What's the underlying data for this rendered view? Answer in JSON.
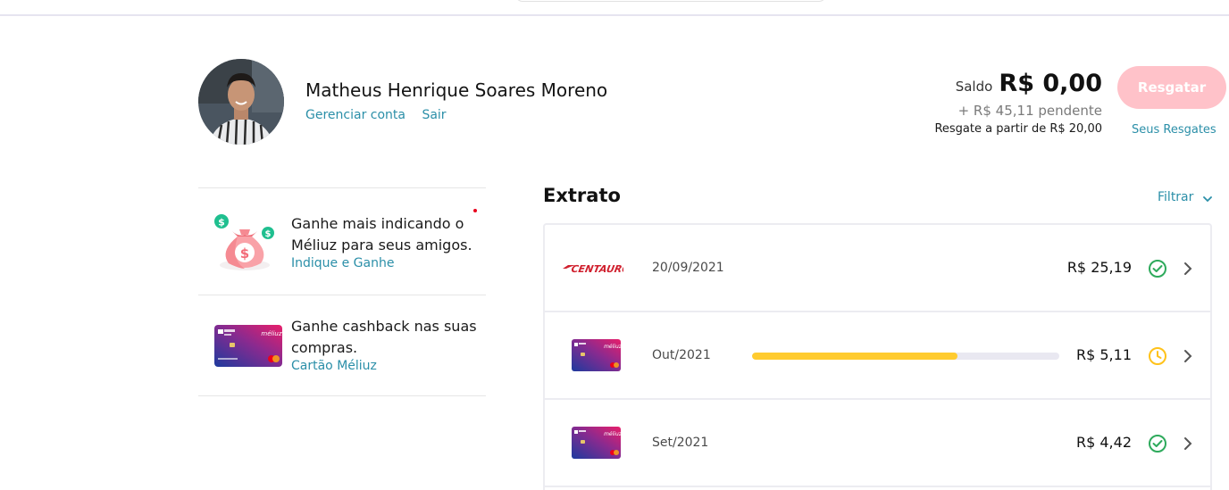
{
  "user": {
    "name": "Matheus Henrique Soares Moreno",
    "manage_label": "Gerenciar conta",
    "logout_label": "Sair"
  },
  "balance": {
    "label": "Saldo",
    "amount": "R$ 0,00",
    "pending": "+ R$ 45,11 pendente",
    "minimum": "Resgate a partir de R$ 20,00",
    "redeem_button": "Resgatar",
    "redeems_link": "Seus Resgates"
  },
  "promos": [
    {
      "text": "Ganhe mais indicando o Méliuz para seus amigos.",
      "link": "Indique e Ganhe",
      "icon": "money-bag-icon"
    },
    {
      "text": "Ganhe cashback nas suas compras.",
      "link": "Cartão Méliuz",
      "icon": "credit-card-icon"
    }
  ],
  "extrato": {
    "title": "Extrato",
    "filter_label": "Filtrar",
    "rows": [
      {
        "logo": "Centauro",
        "date": "20/09/2021",
        "value": "R$ 25,19",
        "status": "confirmed",
        "status_color": "#2eaa5c"
      },
      {
        "logo": "Cartão Méliuz",
        "date": "Out/2021",
        "value": "R$ 5,11",
        "status": "pending",
        "status_color": "#ffc21a",
        "progress": 0.67
      },
      {
        "logo": "Cartão Méliuz",
        "date": "Set/2021",
        "value": "R$ 4,42",
        "status": "confirmed",
        "status_color": "#2eaa5c"
      }
    ]
  },
  "colors": {
    "link": "#2b8fa8",
    "button_disabled": "#ffc2c9",
    "progress_fill": "#ffcb2f",
    "progress_track": "#e9e8f1",
    "brand_red": "#d0202e"
  }
}
